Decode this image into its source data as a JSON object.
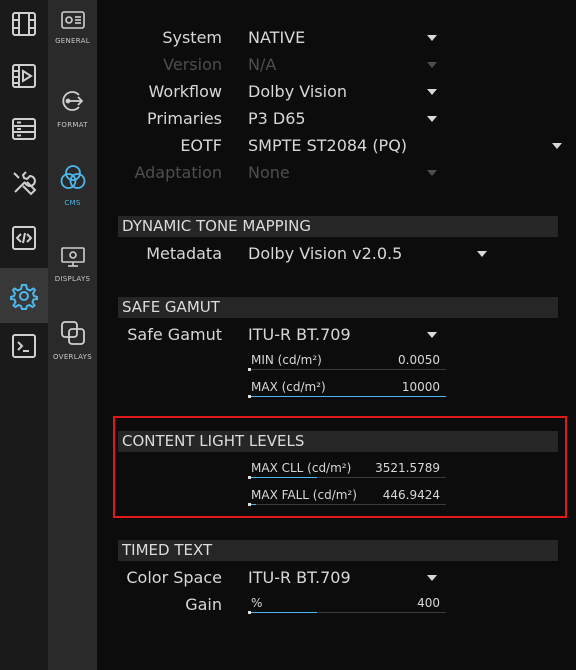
{
  "rail": {
    "items": [
      {
        "icon": "film-strip-icon"
      },
      {
        "icon": "video-file-icon"
      },
      {
        "icon": "storage-icon"
      },
      {
        "icon": "tools-icon"
      },
      {
        "icon": "code-icon"
      },
      {
        "icon": "settings-gear-icon",
        "active": true
      },
      {
        "icon": "terminal-icon"
      }
    ]
  },
  "subnav": {
    "items": [
      {
        "label": "GENERAL",
        "icon": "general-settings-icon"
      },
      {
        "label": "FORMAT",
        "icon": "format-icon"
      },
      {
        "label": "CMS",
        "icon": "cms-color-circles-icon",
        "active": true
      },
      {
        "label": "DISPLAYS",
        "icon": "display-monitor-icon"
      },
      {
        "label": "OVERLAYS",
        "icon": "overlays-icon"
      }
    ]
  },
  "cms": {
    "system": {
      "label": "System",
      "value": "NATIVE"
    },
    "version": {
      "label": "Version",
      "value": "N/A",
      "disabled": true
    },
    "workflow": {
      "label": "Workflow",
      "value": "Dolby Vision"
    },
    "primaries": {
      "label": "Primaries",
      "value": "P3 D65"
    },
    "eotf": {
      "label": "EOTF",
      "value": "SMPTE ST2084 (PQ)"
    },
    "adaptation": {
      "label": "Adaptation",
      "value": "None",
      "disabled": true
    }
  },
  "dynamic_tone_mapping": {
    "title": "DYNAMIC TONE MAPPING",
    "metadata": {
      "label": "Metadata",
      "value": "Dolby Vision v2.0.5"
    }
  },
  "safe_gamut": {
    "title": "SAFE GAMUT",
    "gamut": {
      "label": "Safe Gamut",
      "value": "ITU-R BT.709"
    },
    "min": {
      "label": "MIN (cd/m²)",
      "value": "0.0050",
      "fill": 0
    },
    "max": {
      "label": "MAX (cd/m²)",
      "value": "10000",
      "fill": 1.0
    }
  },
  "content_light_levels": {
    "title": "CONTENT LIGHT LEVELS",
    "max_cll": {
      "label": "MAX CLL (cd/m²)",
      "value": "3521.5789",
      "fill": 0.35
    },
    "max_fall": {
      "label": "MAX FALL (cd/m²)",
      "value": "446.9424",
      "fill": 0.04
    }
  },
  "timed_text": {
    "title": "TIMED TEXT",
    "color_space": {
      "label": "Color Space",
      "value": "ITU-R BT.709"
    },
    "gain": {
      "label": "Gain",
      "unit": "%",
      "value": "400",
      "fill": 0.35
    }
  },
  "colors": {
    "accent": "#4db7ec",
    "highlight_box": "#e01818"
  }
}
